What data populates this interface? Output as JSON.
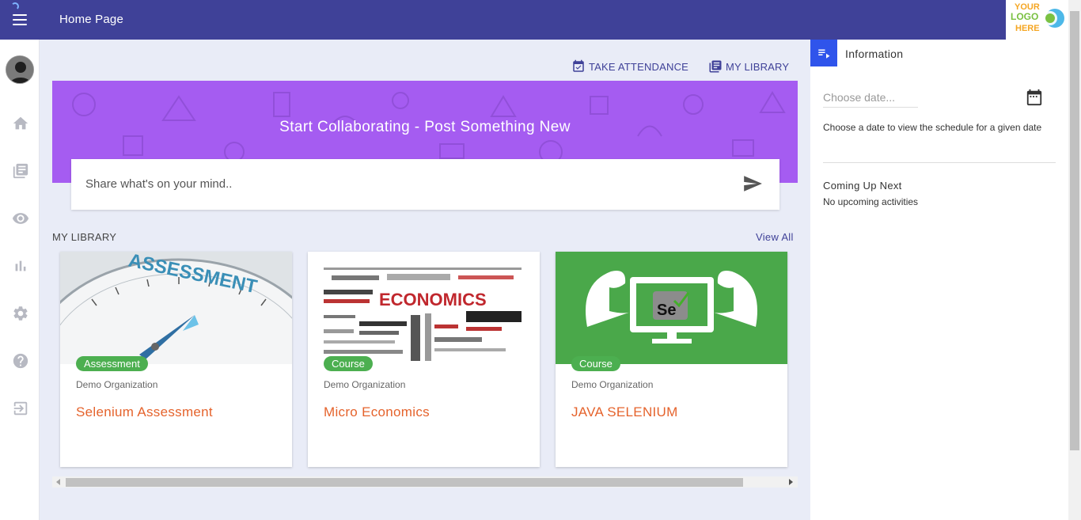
{
  "header": {
    "title": "Home Page",
    "logo_line1": "YOUR",
    "logo_line2": "LOGO",
    "logo_line3": "HERE"
  },
  "sidebar": {
    "items": [
      {
        "icon": "home-icon"
      },
      {
        "icon": "library-icon"
      },
      {
        "icon": "eye-icon"
      },
      {
        "icon": "bar-chart-icon"
      },
      {
        "icon": "gear-icon"
      },
      {
        "icon": "help-icon"
      },
      {
        "icon": "logout-icon"
      }
    ]
  },
  "actions": {
    "take_attendance": "TAKE ATTENDANCE",
    "my_library": "MY LIBRARY"
  },
  "banner": {
    "title": "Start Collaborating - Post Something New",
    "placeholder": "Share what's on your mind.."
  },
  "library": {
    "heading": "MY LIBRARY",
    "view_all": "View All",
    "cards": [
      {
        "badge": "Assessment",
        "org": "Demo Organization",
        "title": "Selenium Assessment",
        "image_word": "ASSESSMENT"
      },
      {
        "badge": "Course",
        "org": "Demo Organization",
        "title": "Micro Economics",
        "image_word": "ECONOMICS"
      },
      {
        "badge": "Course",
        "org": "Demo Organization",
        "title": "JAVA SELENIUM",
        "image_word": "Se"
      }
    ]
  },
  "info_panel": {
    "title": "Information",
    "date_placeholder": "Choose date...",
    "date_help": "Choose a date to view the schedule for a given date",
    "coming_up_title": "Coming Up Next",
    "coming_up_empty": "No upcoming activities"
  },
  "colors": {
    "header": "#3f4198",
    "banner": "#a55cf1",
    "badge": "#4caf50",
    "card_title": "#e5632c",
    "info_tab": "#2f54eb"
  }
}
